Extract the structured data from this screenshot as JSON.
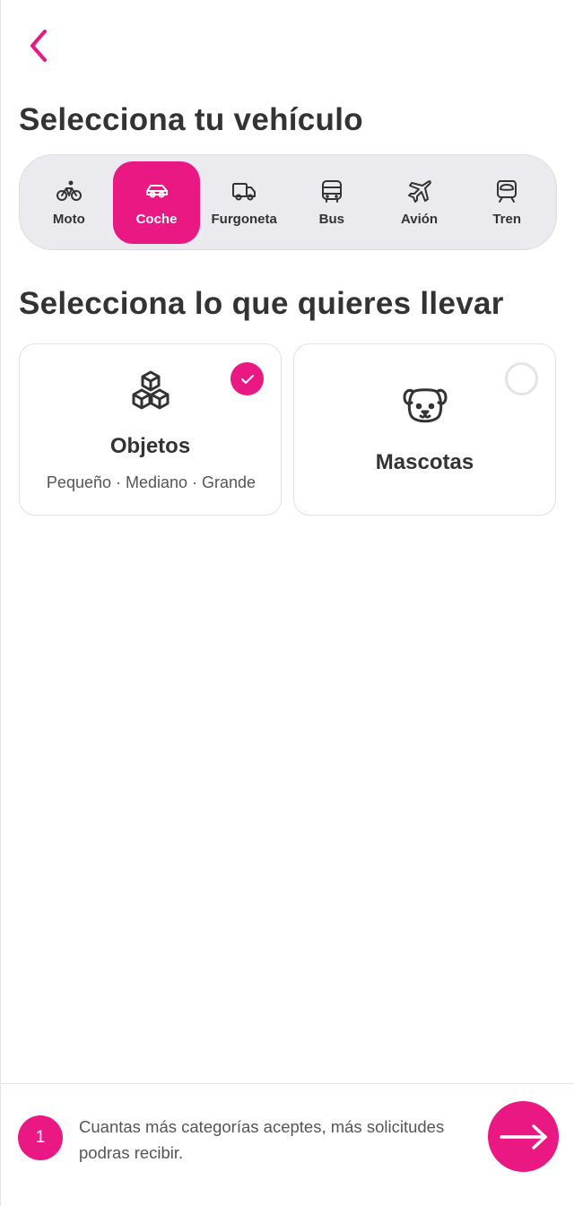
{
  "header": {
    "back_icon": "chevron-left-icon"
  },
  "vehicle_section": {
    "title": "Selecciona tu vehículo",
    "selected": "Coche",
    "items": [
      {
        "label": "Moto",
        "icon": "bicycle-icon"
      },
      {
        "label": "Coche",
        "icon": "car-icon"
      },
      {
        "label": "Furgoneta",
        "icon": "van-icon"
      },
      {
        "label": "Bus",
        "icon": "bus-icon"
      },
      {
        "label": "Avión",
        "icon": "plane-icon"
      },
      {
        "label": "Tren",
        "icon": "train-icon"
      }
    ]
  },
  "load_section": {
    "title": "Selecciona lo que quieres llevar",
    "cards": [
      {
        "title": "Objetos",
        "subtitle": "Pequeño · Mediano · Grande",
        "icon": "boxes-icon",
        "checked": true
      },
      {
        "title": "Mascotas",
        "icon": "dog-icon",
        "checked": false
      }
    ]
  },
  "footer": {
    "count": "1",
    "hint": "Cuantas más categorías aceptes, más solicitudes podras recibir.",
    "next_icon": "arrow-right-icon"
  },
  "colors": {
    "accent": "#ea1882",
    "text": "#333333",
    "bar_bg": "#ebebef"
  }
}
